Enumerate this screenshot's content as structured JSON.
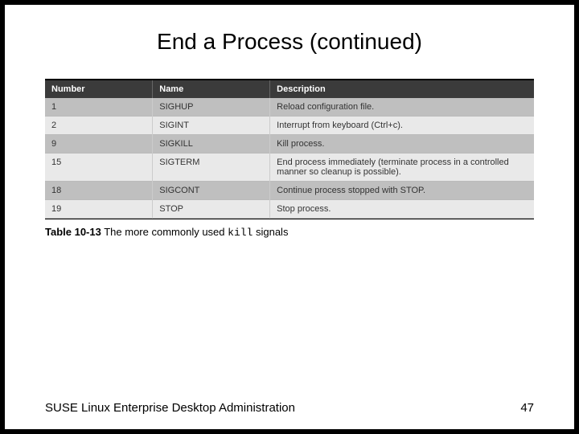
{
  "title": "End a Process (continued)",
  "chart_data": {
    "type": "table",
    "headers": [
      "Number",
      "Name",
      "Description"
    ],
    "rows": [
      {
        "number": "1",
        "name": "SIGHUP",
        "description": "Reload configuration file."
      },
      {
        "number": "2",
        "name": "SIGINT",
        "description": "Interrupt from keyboard (Ctrl+c)."
      },
      {
        "number": "9",
        "name": "SIGKILL",
        "description": "Kill process."
      },
      {
        "number": "15",
        "name": "SIGTERM",
        "description": "End process immediately (terminate process in a controlled manner so cleanup is possible)."
      },
      {
        "number": "18",
        "name": "SIGCONT",
        "description": "Continue process stopped with STOP."
      },
      {
        "number": "19",
        "name": "STOP",
        "description": "Stop process."
      }
    ]
  },
  "caption": {
    "label": "Table 10-13",
    "text_before": " The more commonly used ",
    "code": "kill",
    "text_after": " signals"
  },
  "footer": {
    "left": "SUSE Linux Enterprise Desktop Administration",
    "right": "47"
  }
}
